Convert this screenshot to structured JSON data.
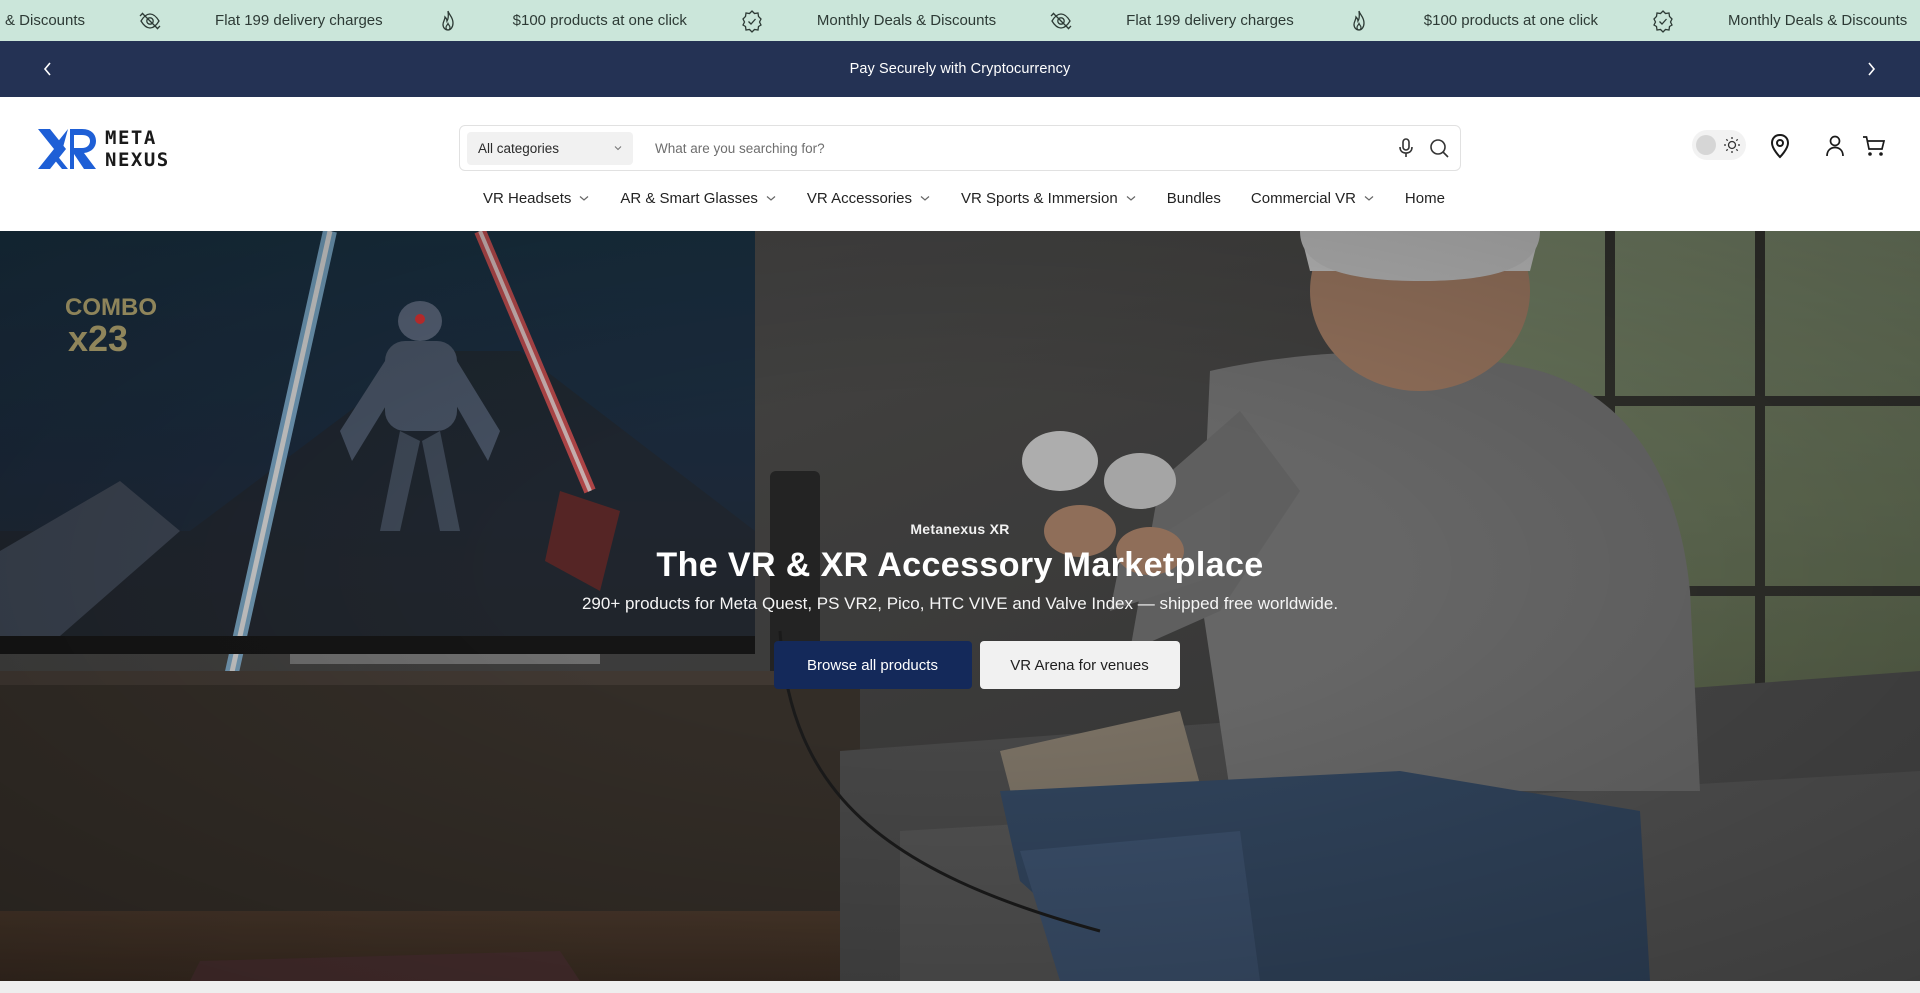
{
  "ticker": {
    "items": [
      {
        "icon": "tag-badge-icon",
        "text": "Monthly Deals & Discounts"
      },
      {
        "icon": "delivery-eye-icon",
        "text": "Flat 199 delivery charges"
      },
      {
        "icon": "flame-icon",
        "text": "$100 products at one click"
      },
      {
        "icon": "verified-badge-icon",
        "text": "Monthly Deals & Discounts"
      },
      {
        "icon": "delivery-eye-icon",
        "text": "Flat 199 delivery charges"
      },
      {
        "icon": "flame-icon",
        "text": "$100 products at one click"
      },
      {
        "icon": "verified-badge-icon",
        "text": "Monthly Deals & Discounts"
      }
    ],
    "first_partial": "& Discounts"
  },
  "announcement": {
    "message": "Pay Securely with Cryptocurrency"
  },
  "header": {
    "logo_line1": "META",
    "logo_line2": "NEXUS",
    "search": {
      "category_label": "All categories",
      "placeholder": "What are you searching for?"
    },
    "nav": [
      {
        "label": "VR Headsets",
        "dropdown": true
      },
      {
        "label": "AR & Smart Glasses",
        "dropdown": true
      },
      {
        "label": "VR Accessories",
        "dropdown": true
      },
      {
        "label": "VR Sports & Immersion",
        "dropdown": true
      },
      {
        "label": "Bundles",
        "dropdown": false
      },
      {
        "label": "Commercial VR",
        "dropdown": true
      },
      {
        "label": "Home",
        "dropdown": false
      }
    ]
  },
  "hero": {
    "eyebrow": "Metanexus XR",
    "title": "The VR & XR Accessory Marketplace",
    "subtitle": "290+ products for Meta Quest, PS VR2, Pico, HTC VIVE and Valve Index — shipped free worldwide.",
    "primary_cta": "Browse all products",
    "secondary_cta": "VR Arena for venues",
    "tv_text_line1": "COMBO",
    "tv_text_line2": "x23"
  },
  "colors": {
    "ticker_bg": "#cbe6da",
    "announce_bg": "#243254",
    "primary_btn": "#14295a"
  }
}
